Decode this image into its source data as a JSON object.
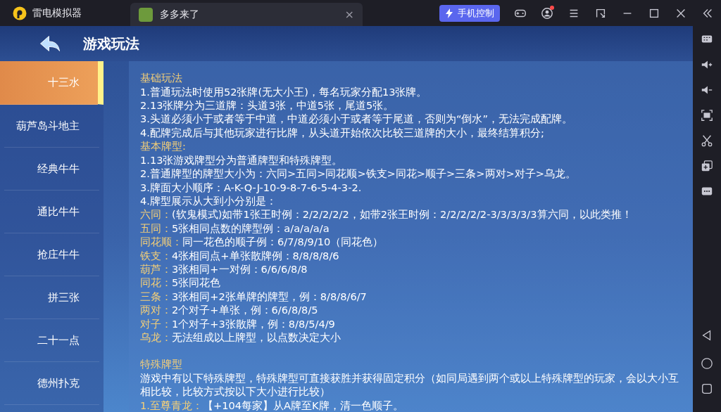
{
  "titlebar": {
    "app_name": "雷电模拟器",
    "tabs": [
      {
        "label": "多多来了",
        "selected": true,
        "close": "×"
      }
    ],
    "control_button": "手机控制",
    "notification": true
  },
  "header": {
    "title": "游戏玩法"
  },
  "sidebar": {
    "items": [
      {
        "label": "十三水",
        "selected": true
      },
      {
        "label": "葫芦岛斗地主",
        "selected": false
      },
      {
        "label": "经典牛牛",
        "selected": false
      },
      {
        "label": "通比牛牛",
        "selected": false
      },
      {
        "label": "抢庄牛牛",
        "selected": false
      },
      {
        "label": "拼三张",
        "selected": false
      },
      {
        "label": "二十一点",
        "selected": false
      },
      {
        "label": "德州扑克",
        "selected": false
      }
    ]
  },
  "rules": {
    "basic": {
      "title": "基础玩法",
      "lines": [
        {
          "kind": "text",
          "text": "1.普通玩法时使用52张牌(无大小王)，每名玩家分配13张牌。"
        },
        {
          "kind": "text",
          "text": "2.13张牌分为三道牌：头道3张，中道5张，尾道5张。"
        },
        {
          "kind": "text",
          "text": "3.头道必须小于或者等于中道，中道必须小于或者等于尾道，否则为“倒水”，无法完成配牌。"
        },
        {
          "kind": "text",
          "text": "4.配牌完成后与其他玩家进行比牌，从头道开始依次比较三道牌的大小，最终结算积分;"
        }
      ]
    },
    "types": {
      "title": "基本牌型:",
      "lines": [
        {
          "kind": "text",
          "text": "1.13张游戏牌型分为普通牌型和特殊牌型。"
        },
        {
          "kind": "text",
          "text": "2.普通牌型的牌型大小为：六同>五同>同花顺>铁支>同花>顺子>三条>两对>对子>乌龙。"
        },
        {
          "kind": "text",
          "text": "3.牌面大小顺序：A-K-Q-J-10-9-8-7-6-5-4-3-2."
        },
        {
          "kind": "text",
          "text": "4.牌型展示从大到小分别是："
        },
        {
          "kind": "entry",
          "label": "六同：",
          "text": "(软鬼模式)如带1张王时例：2/2/2/2/2，如带2张王时例：2/2/2/2/2-3/3/3/3/3算六同，以此类推！"
        },
        {
          "kind": "entry",
          "label": "五同：",
          "text": "5张相同点数的牌型例：a/a/a/a/a"
        },
        {
          "kind": "entry",
          "label": "同花顺：",
          "text": "同一花色的顺子例：6/7/8/9/10（同花色）"
        },
        {
          "kind": "entry",
          "label": "铁支：",
          "text": "4张相同点+单张散牌例：8/8/8/8/6"
        },
        {
          "kind": "entry",
          "label": "葫芦：",
          "text": "3张相同+一对例：6/6/6/8/8"
        },
        {
          "kind": "entry",
          "label": "同花：",
          "text": "5张同花色"
        },
        {
          "kind": "entry",
          "label": "三条：",
          "text": "3张相同+2张单牌的牌型，例：8/8/8/6/7"
        },
        {
          "kind": "entry",
          "label": "两对：",
          "text": "2个对子+单张，例：6/6/8/8/5"
        },
        {
          "kind": "entry",
          "label": "对子：",
          "text": "1个对子+3张散牌，例：8/8/5/4/9"
        },
        {
          "kind": "entry",
          "label": "乌龙：",
          "text": "无法组成以上牌型，以点数决定大小"
        }
      ]
    },
    "special": {
      "title": "特殊牌型",
      "lines": [
        {
          "kind": "text",
          "text": "游戏中有以下特殊牌型，特殊牌型可直接获胜并获得固定积分（如同局遇到两个或以上特殊牌型的玩家，会以大小互相比较，比较方式按以下大小进行比较）"
        },
        {
          "kind": "entry",
          "label": "1.至尊青龙：",
          "text": "【+104每家】从A牌至K牌，清一色顺子。"
        }
      ]
    }
  }
}
